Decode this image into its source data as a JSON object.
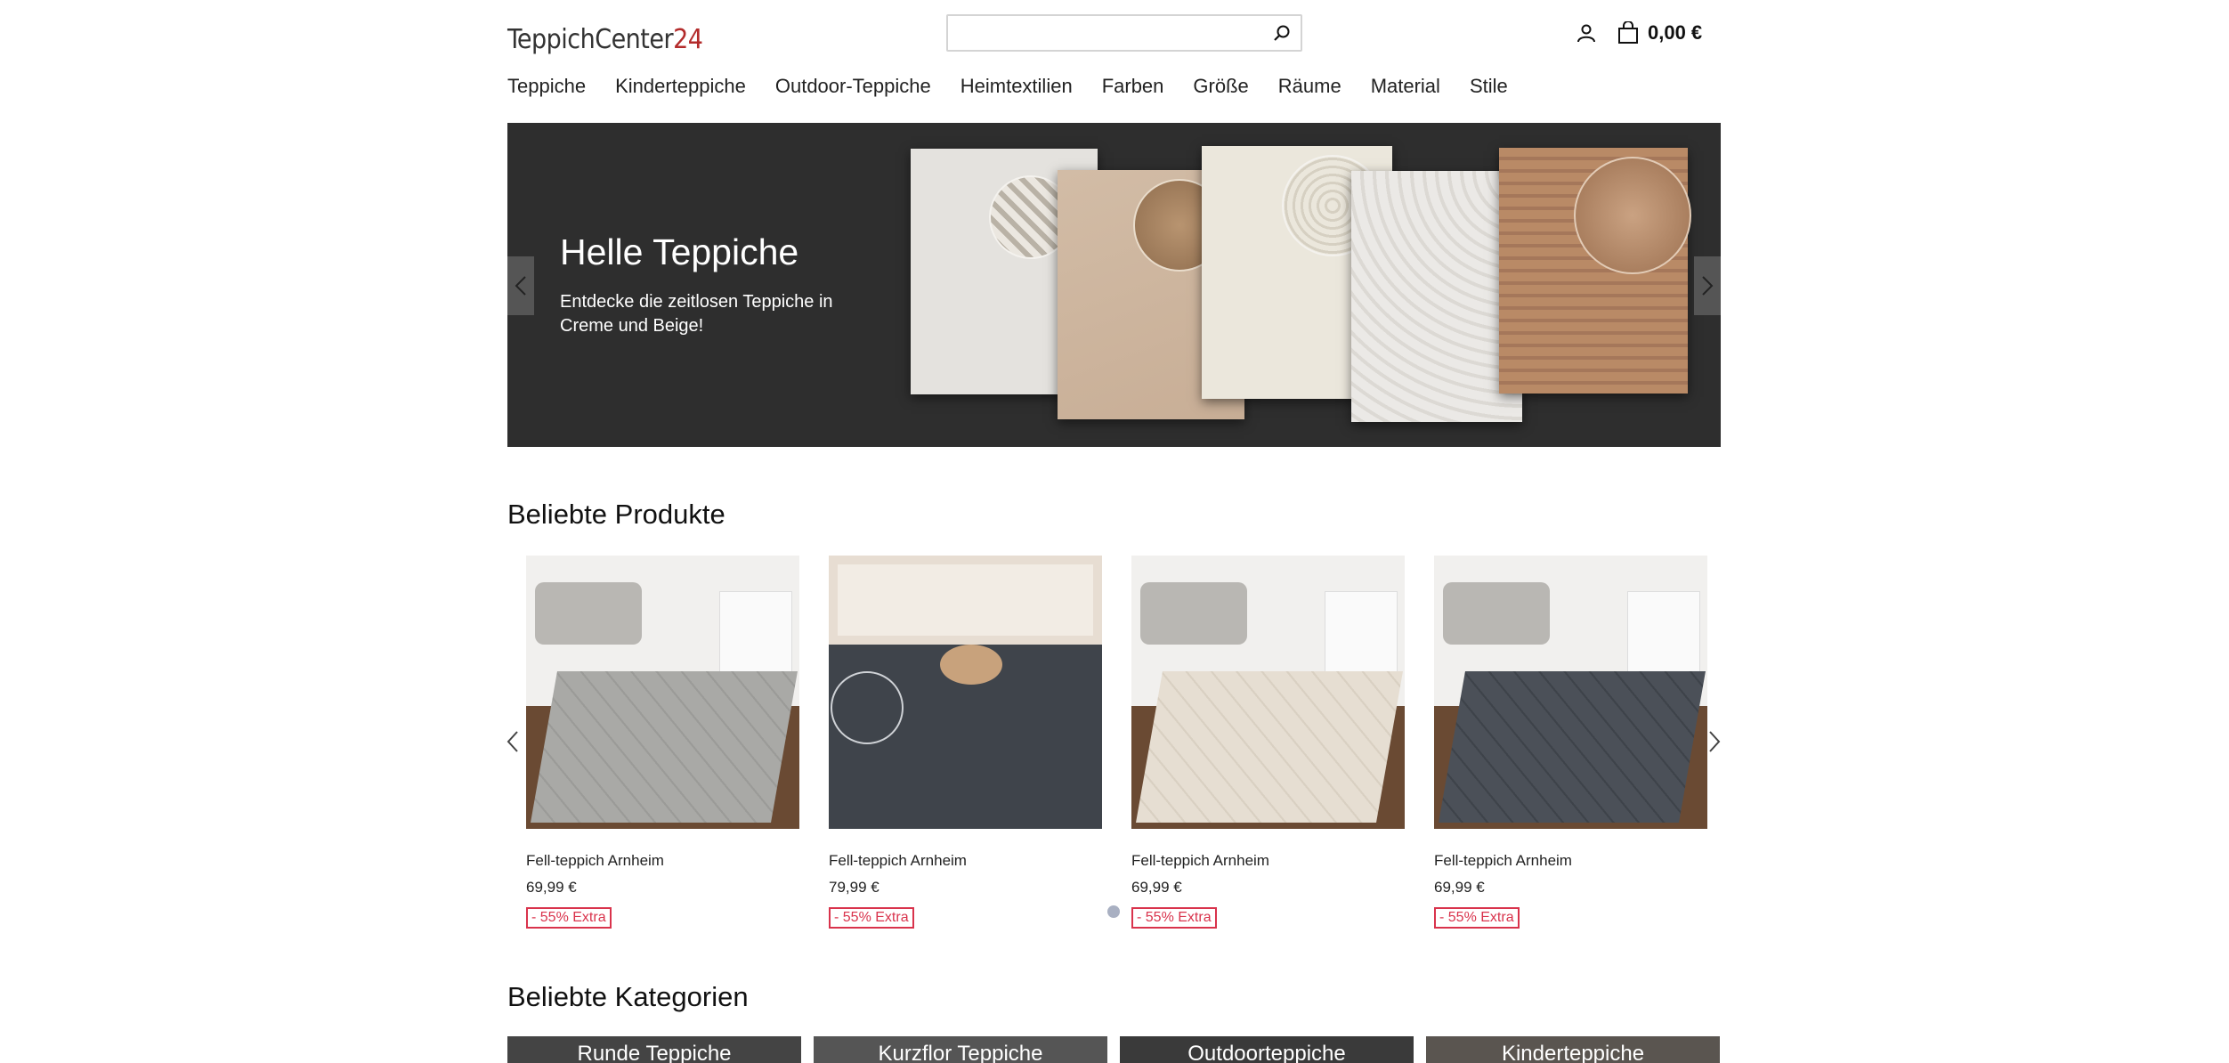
{
  "header": {
    "logo_main": "TeppichCenter",
    "logo_accent": "24",
    "search_placeholder": "",
    "cart_total": "0,00 €"
  },
  "nav": [
    "Teppiche",
    "Kinderteppiche",
    "Outdoor-Teppiche",
    "Heimtextilien",
    "Farben",
    "Größe",
    "Räume",
    "Material",
    "Stile"
  ],
  "hero": {
    "title": "Helle Teppiche",
    "subtitle": "Entdecke die zeitlosen Teppiche in Creme und Beige!"
  },
  "popular": {
    "heading": "Beliebte Produkte",
    "products": [
      {
        "name": "Fell-teppich Arnheim",
        "price": "69,99 €",
        "badge": "- 55% Extra",
        "rug_color": "#a9a9a6"
      },
      {
        "name": "Fell-teppich Arnheim",
        "price": "79,99 €",
        "badge": "- 55% Extra",
        "rug_color": "#3f444b"
      },
      {
        "name": "Fell-teppich Arnheim",
        "price": "69,99 €",
        "badge": "- 55% Extra",
        "rug_color": "#e6ded2"
      },
      {
        "name": "Fell-teppich Arnheim",
        "price": "69,99 €",
        "badge": "- 55% Extra",
        "rug_color": "#4b5058"
      }
    ]
  },
  "categories": {
    "heading": "Beliebte Kategorien",
    "items": [
      "Runde Teppiche",
      "Kurzflor Teppiche",
      "Outdoorteppiche",
      "Kinderteppiche"
    ]
  },
  "colors": {
    "hero_bg": "#2e2e2e",
    "badge": "#d9334c",
    "logo_accent": "#b32b2b"
  },
  "icons": [
    "search-icon",
    "user-icon",
    "cart-icon",
    "chevron-left-icon",
    "chevron-right-icon"
  ]
}
